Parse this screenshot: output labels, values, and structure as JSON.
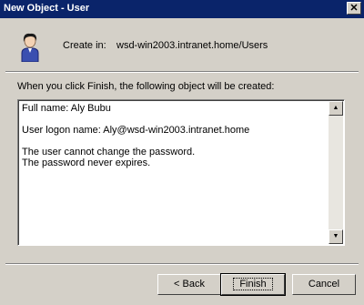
{
  "window": {
    "title": "New Object - User",
    "close_glyph": "✕"
  },
  "header": {
    "create_in_label": "Create in:",
    "create_in_path": "wsd-win2003.intranet.home/Users"
  },
  "intro_text": "When you click Finish, the following object will be created:",
  "summary_lines": [
    "Full name: Aly Bubu",
    "",
    "User logon name: Aly@wsd-win2003.intranet.home",
    "",
    "The user cannot change the password.",
    "The password never expires."
  ],
  "scrollbar": {
    "up_glyph": "▲",
    "down_glyph": "▼"
  },
  "buttons": {
    "back": "< Back",
    "finish": "Finish",
    "cancel": "Cancel"
  },
  "icons": {
    "user": "user-icon"
  }
}
